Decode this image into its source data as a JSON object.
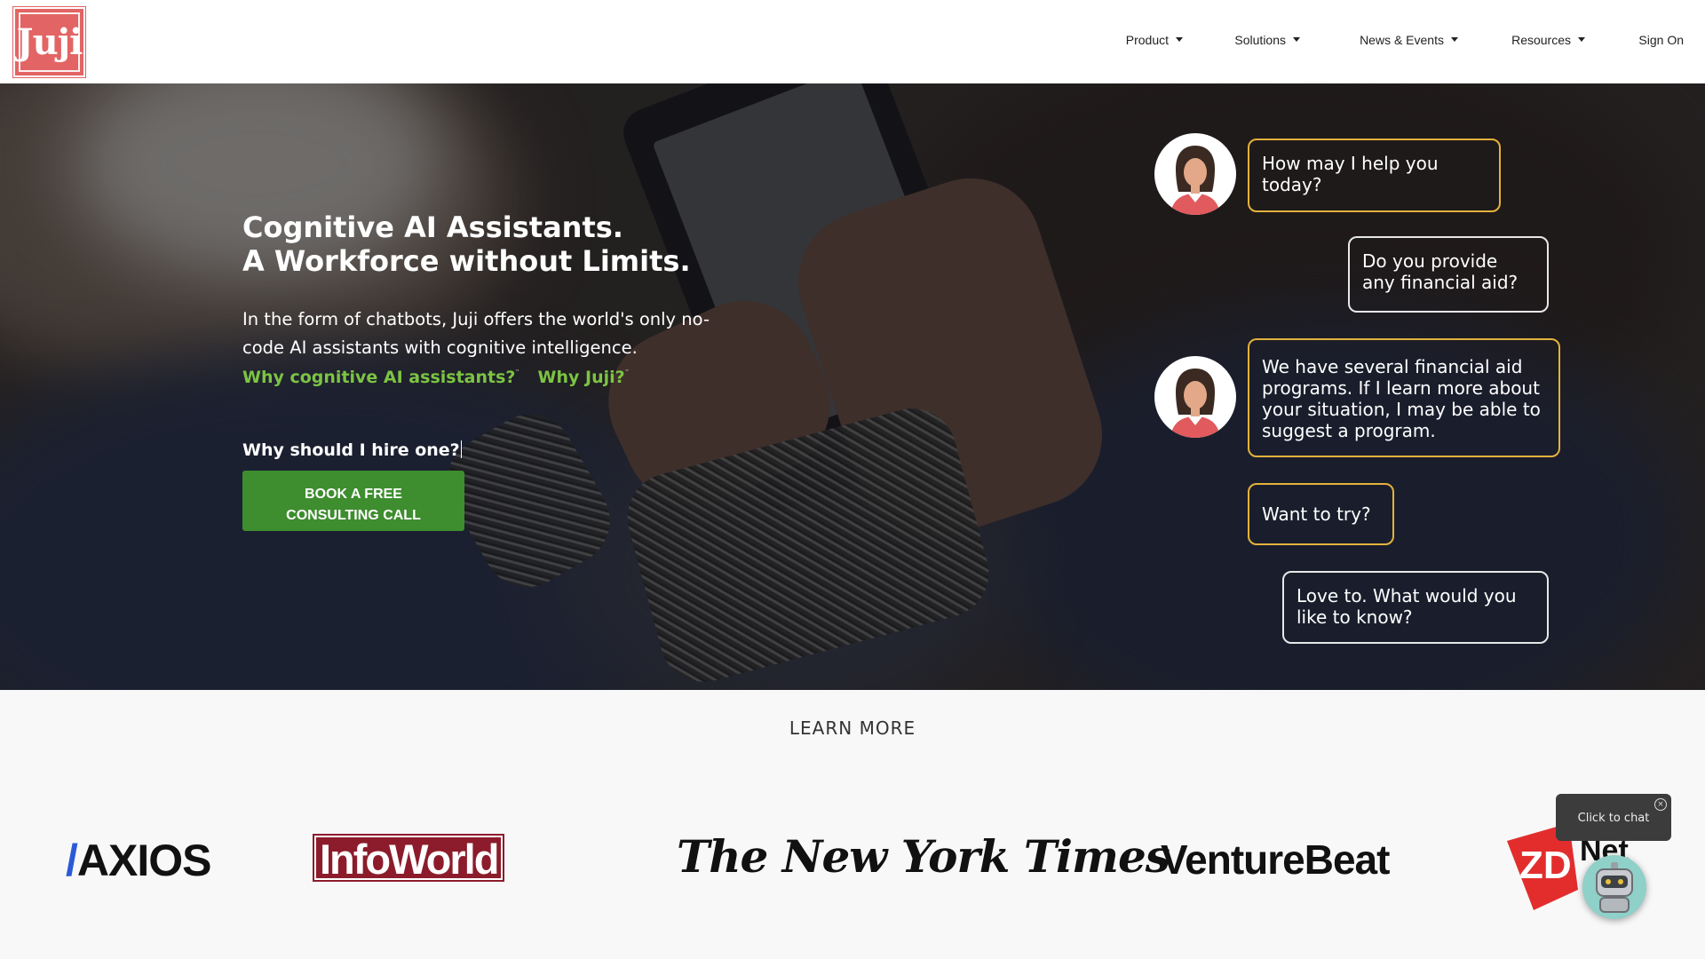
{
  "brand": {
    "logo_text": "Juji",
    "color": "#e36464"
  },
  "nav": {
    "items": [
      {
        "label": "Product",
        "has_dropdown": true
      },
      {
        "label": "Solutions",
        "has_dropdown": true
      },
      {
        "label": "News & Events",
        "has_dropdown": true
      },
      {
        "label": "Resources",
        "has_dropdown": true
      },
      {
        "label": "Sign On",
        "has_dropdown": false
      }
    ]
  },
  "hero": {
    "title_line1": "Cognitive AI Assistants.",
    "title_line2": "A Workforce without Limits.",
    "subtitle": "In the form of chatbots, Juji offers the world's only no-code AI assistants with cognitive intelligence.",
    "link1": "Why cognitive AI assistants?",
    "link2": "Why Juji?",
    "hire_question": "Why should I hire one?",
    "cta_line1": "BOOK A FREE",
    "cta_line2": "CONSULTING CALL",
    "accent_color": "#7cc443",
    "cta_color": "#3e8d2f"
  },
  "chat": {
    "messages": [
      {
        "role": "bot",
        "text": "How may I help you today?"
      },
      {
        "role": "user",
        "text": "Do you provide any financial aid?"
      },
      {
        "role": "bot",
        "text": "We have several financial aid programs. If I learn more about your situation, I may be able to suggest a program."
      },
      {
        "role": "bot",
        "text": "Want to try?"
      },
      {
        "role": "user",
        "text": "Love to. What would you like to know?"
      }
    ],
    "bot_border_color": "#e3b23c"
  },
  "learn_more": {
    "title": "LEARN MORE",
    "press_logos": [
      "AXIOS",
      "InfoWorld",
      "The New York Times",
      "VentureBeat",
      "ZDNet"
    ]
  },
  "widget": {
    "tooltip": "Click to chat",
    "icon": "robot-icon"
  }
}
